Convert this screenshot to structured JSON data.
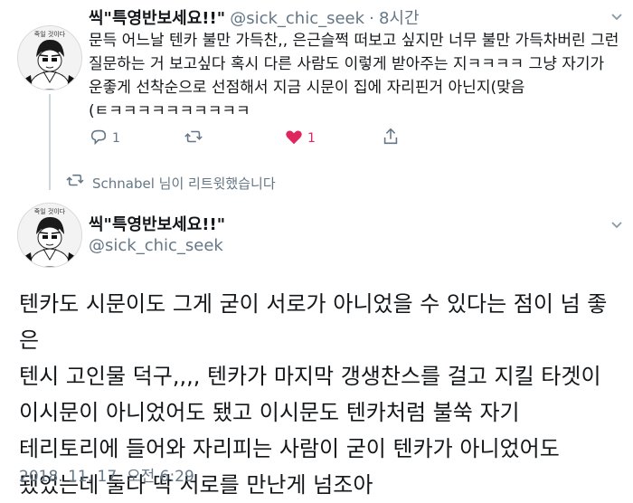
{
  "tweet1": {
    "display_name": "씩\"특영반보세요!!\"",
    "handle": "@sick_chic_seek",
    "separator": "·",
    "time": "8시간",
    "text": "문득 어느날 텐카 불만 가득찬,, 은근슬쩍 떠보고 싶지만 너무 불만 가득차버린 그런\n질문하는 거 보고싶다 혹시 다른 사람도 이렇게 받아주는 지ㅋㅋㅋㅋ 그냥 자기가\n운좋게 선착순으로 선점해서 지금 시문이 집에 자리핀거 아닌지(맞음\n(ㅌㅋㅋㅋㅋㅋㅋㅋㅋㅋㅋ",
    "reply_count": "1",
    "like_count": "1",
    "avatar_caption": "죽일 것이다"
  },
  "retweet_notice": "Schnabel 님이 리트윗했습니다",
  "tweet2": {
    "display_name": "씩\"특영반보세요!!\"",
    "handle": "@sick_chic_seek",
    "avatar_caption": "죽일 것이다",
    "text": "텐카도 시문이도 그게 굳이 서로가 아니었을 수 있다는 점이 넘 좋은\n텐시 고인물 덕구,,,, 텐카가 마지막 갱생찬스를 걸고 지킬 타겟이\n이시문이 아니었어도 됐고 이시문도 텐카처럼 불쑥 자기\n테리토리에 들어와 자리피는 사람이 굳이 텐카가 아니었어도\n됐었는데 둘다 딱 서로를 만난게 넘조아",
    "timestamp": "2018. 11. 17. 오전 6:29"
  },
  "colors": {
    "text": "#14171a",
    "secondary": "#657786",
    "like": "#e0245e",
    "line": "#ccd6dd"
  }
}
